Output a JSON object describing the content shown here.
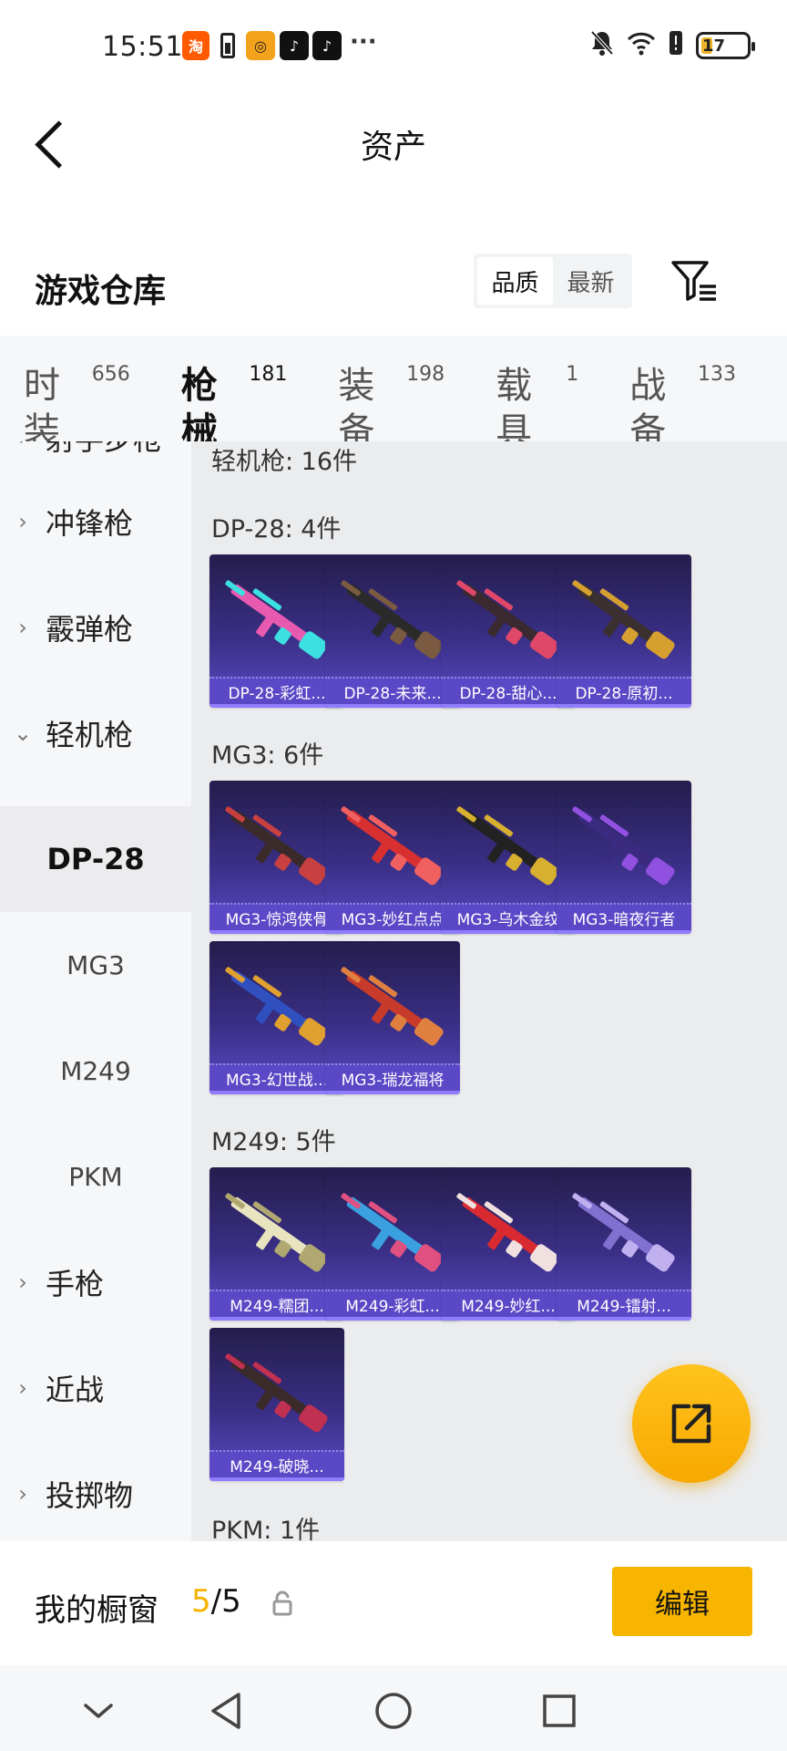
{
  "status_bar": {
    "time": "15:51",
    "apps": [
      "taobao-icon",
      "battery-saver-icon",
      "yellow-app-icon",
      "tiktok-icon",
      "tiktok-icon"
    ],
    "more": "···",
    "battery": "17"
  },
  "header": {
    "title": "资产"
  },
  "warehouse": {
    "title": "游戏仓库",
    "sort_options": [
      "品质",
      "最新"
    ],
    "active_sort": "品质"
  },
  "tabs": [
    {
      "label": "时装",
      "count": "656"
    },
    {
      "label": "枪械",
      "count": "181",
      "active": true
    },
    {
      "label": "装备",
      "count": "198"
    },
    {
      "label": "载具",
      "count": "1"
    },
    {
      "label": "战备",
      "count": "133"
    }
  ],
  "sidebar": {
    "items": [
      {
        "label": "射手步枪",
        "type": "category",
        "expanded": false
      },
      {
        "label": "冲锋枪",
        "type": "category",
        "expanded": false
      },
      {
        "label": "霰弹枪",
        "type": "category",
        "expanded": false
      },
      {
        "label": "轻机枪",
        "type": "category",
        "expanded": true
      },
      {
        "label": "DP-28",
        "type": "sub",
        "selected": true
      },
      {
        "label": "MG3",
        "type": "sub"
      },
      {
        "label": "M249",
        "type": "sub"
      },
      {
        "label": "PKM",
        "type": "sub"
      },
      {
        "label": "手枪",
        "type": "category",
        "expanded": false
      },
      {
        "label": "近战",
        "type": "category",
        "expanded": false
      },
      {
        "label": "投掷物",
        "type": "category",
        "expanded": false
      }
    ]
  },
  "content": {
    "summary": "轻机枪: 16件",
    "groups": [
      {
        "title": "DP-28: 4件",
        "items": [
          {
            "name": "DP-28-彩虹...",
            "palette": [
              "#e85ab0",
              "#3de0e0"
            ]
          },
          {
            "name": "DP-28-未来...",
            "palette": [
              "#2a2a2a",
              "#7a5a40"
            ]
          },
          {
            "name": "DP-28-甜心...",
            "palette": [
              "#3a2a30",
              "#e0486a"
            ]
          },
          {
            "name": "DP-28-原初...",
            "palette": [
              "#3a3030",
              "#d6a030"
            ]
          }
        ]
      },
      {
        "title": "MG3: 6件",
        "items": [
          {
            "name": "MG3-惊鸿侠骨",
            "palette": [
              "#3a2a2a",
              "#c84040"
            ]
          },
          {
            "name": "MG3-妙红点点",
            "palette": [
              "#d83030",
              "#f06060"
            ]
          },
          {
            "name": "MG3-乌木金纹",
            "palette": [
              "#222222",
              "#d8b030"
            ]
          },
          {
            "name": "MG3-暗夜行者",
            "palette": [
              "#3a2a80",
              "#9050e0"
            ]
          },
          {
            "name": "MG3-幻世战...",
            "palette": [
              "#3050c0",
              "#e0a030"
            ]
          },
          {
            "name": "MG3-瑞龙福将",
            "palette": [
              "#c83a2a",
              "#e08040"
            ]
          }
        ]
      },
      {
        "title": "M249: 5件",
        "items": [
          {
            "name": "M249-糯团...",
            "palette": [
              "#e8e4c0",
              "#b0a870"
            ]
          },
          {
            "name": "M249-彩虹...",
            "palette": [
              "#3aa0e0",
              "#e05080"
            ]
          },
          {
            "name": "M249-妙红...",
            "palette": [
              "#d82a30",
              "#f0e0e0"
            ]
          },
          {
            "name": "M249-镭射...",
            "palette": [
              "#8070d0",
              "#c0b0f0"
            ]
          },
          {
            "name": "M249-破晓...",
            "palette": [
              "#3a2a2a",
              "#c03050"
            ]
          }
        ]
      },
      {
        "title": "PKM: 1件",
        "items": []
      }
    ]
  },
  "bottom": {
    "showcase_label": "我的橱窗",
    "showcase_current": "5",
    "showcase_total": "/5",
    "edit_label": "编辑"
  },
  "colors": {
    "accent": "#f5b300",
    "card_footer": "#5a48c6"
  }
}
